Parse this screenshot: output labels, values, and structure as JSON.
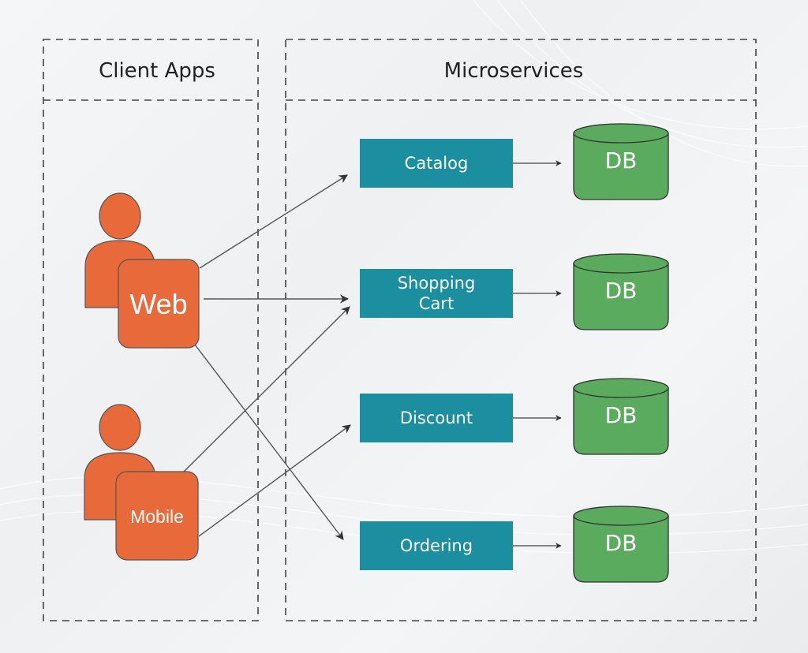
{
  "sections": {
    "client_apps": {
      "title": "Client Apps"
    },
    "microservices": {
      "title": "Microservices"
    }
  },
  "clients": [
    {
      "id": "web",
      "label": "Web",
      "icon": "user-icon"
    },
    {
      "id": "mobile",
      "label": "Mobile",
      "icon": "user-icon"
    }
  ],
  "services": [
    {
      "id": "catalog",
      "label_lines": [
        "Catalog"
      ],
      "db_label": "DB"
    },
    {
      "id": "shopping-cart",
      "label_lines": [
        "Shopping",
        "Cart"
      ],
      "db_label": "DB"
    },
    {
      "id": "discount",
      "label_lines": [
        "Discount"
      ],
      "db_label": "DB"
    },
    {
      "id": "ordering",
      "label_lines": [
        "Ordering"
      ],
      "db_label": "DB"
    }
  ],
  "connections": [
    {
      "from": "web",
      "to": "catalog"
    },
    {
      "from": "web",
      "to": "shopping-cart"
    },
    {
      "from": "web",
      "to": "ordering"
    },
    {
      "from": "mobile",
      "to": "shopping-cart"
    },
    {
      "from": "mobile",
      "to": "discount"
    }
  ],
  "colors": {
    "client": "#e8693a",
    "service": "#1b8fa0",
    "database": "#5aab5e",
    "stroke": "#444444"
  }
}
